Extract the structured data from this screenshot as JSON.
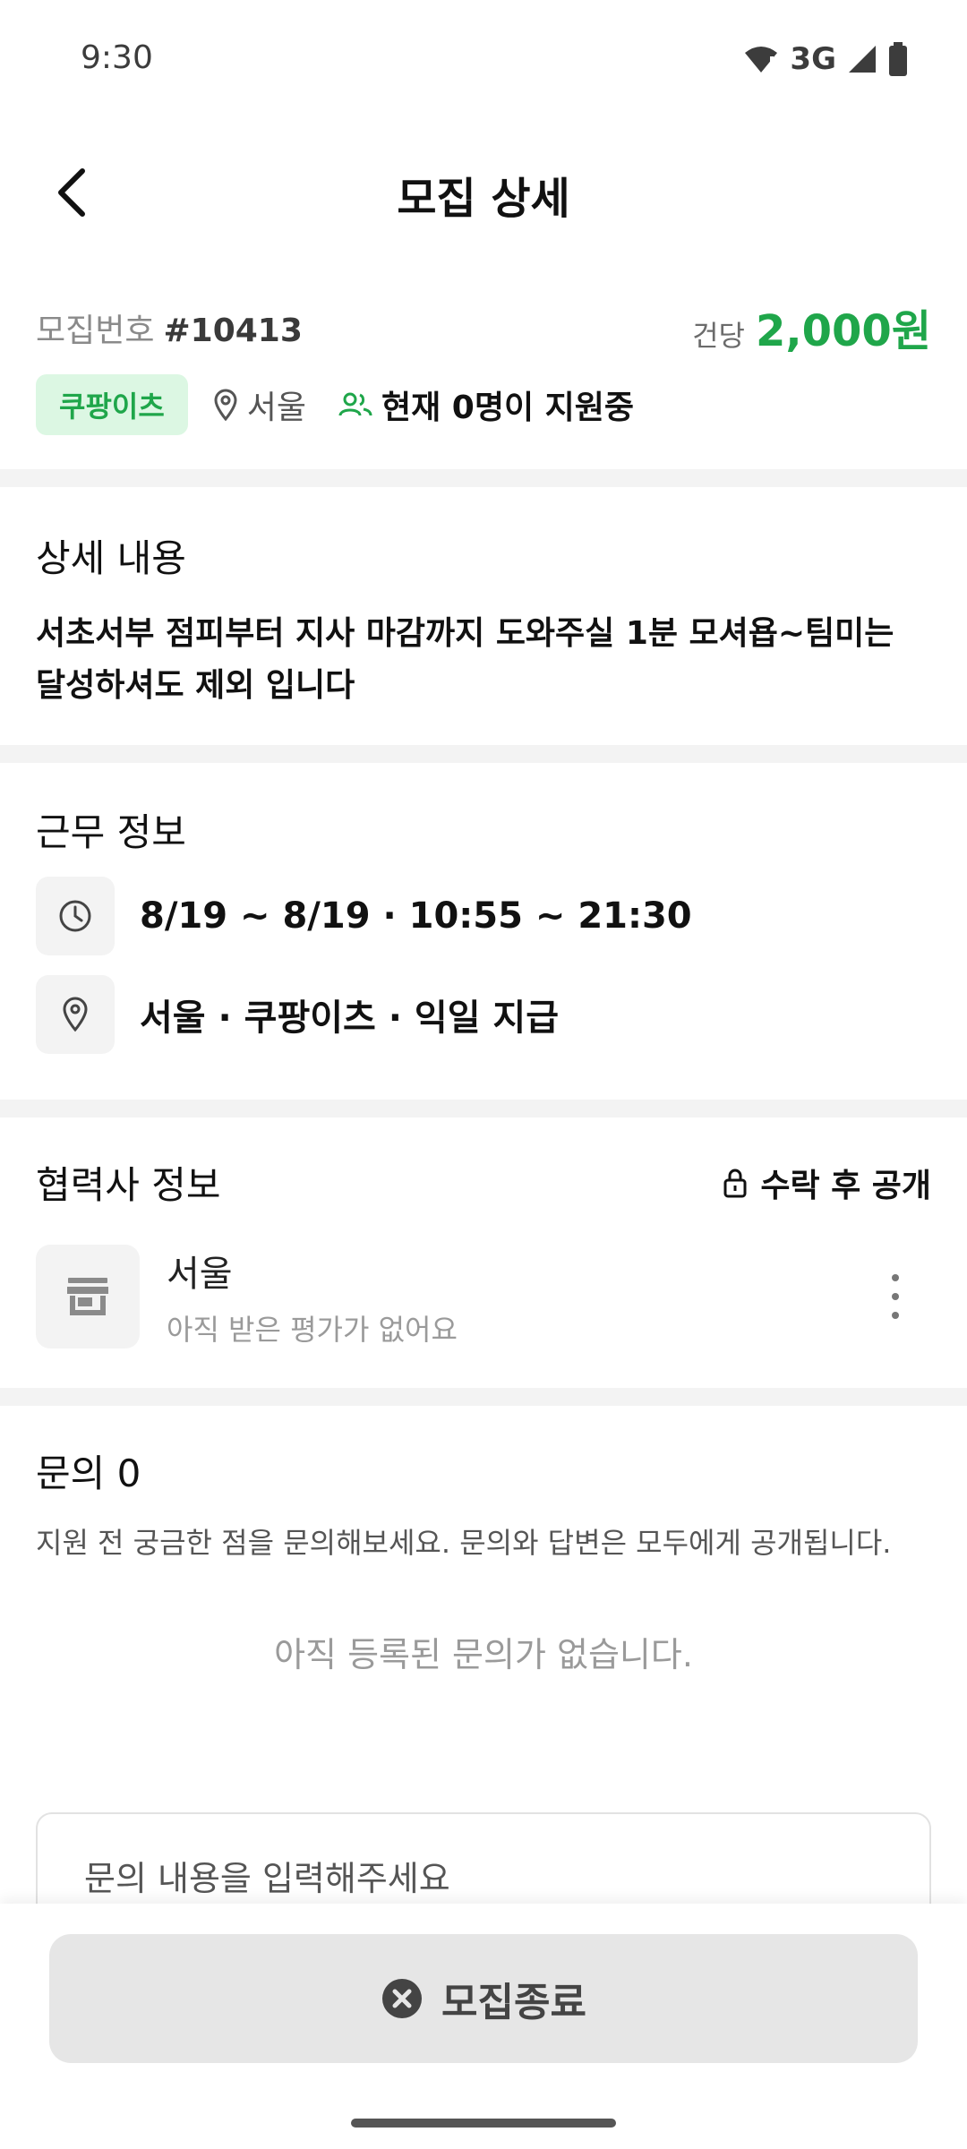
{
  "status_bar": {
    "time": "9:30",
    "network": "3G"
  },
  "header": {
    "title": "모집 상세"
  },
  "summary": {
    "recruit_no_label": "모집번호",
    "recruit_no": "#10413",
    "price_label": "건당",
    "price_value": "2,000원",
    "platform": "쿠팡이츠",
    "location": "서울",
    "applicants": "현재 0명이 지원중"
  },
  "details": {
    "title": "상세 내용",
    "body": "서초서부 점피부터 지사 마감까지 도와주실 1분 모셔욥~팀미는 달성하셔도 제외 입니다"
  },
  "work": {
    "title": "근무 정보",
    "schedule": "8/19 ~ 8/19 · 10:55 ~ 21:30",
    "place": "서울  · 쿠팡이츠 · 익일 지급"
  },
  "partner": {
    "title": "협력사 정보",
    "lock_text": "수락 후 공개",
    "name": "서울",
    "rating_text": "아직 받은 평가가 없어요"
  },
  "inquiry": {
    "title": "문의 0",
    "description": "지원 전 궁금한 점을 문의해보세요. 문의와 답변은 모두에게 공개됩니다.",
    "empty_text": "아직 등록된 문의가 없습니다.",
    "input_placeholder": "문의 내용을 입력해주세요"
  },
  "bottom": {
    "close_label": "모집종료"
  },
  "colors": {
    "accent": "#1fa64a",
    "badge_bg": "#dcf7e3",
    "divider": "#f3f3f3"
  }
}
